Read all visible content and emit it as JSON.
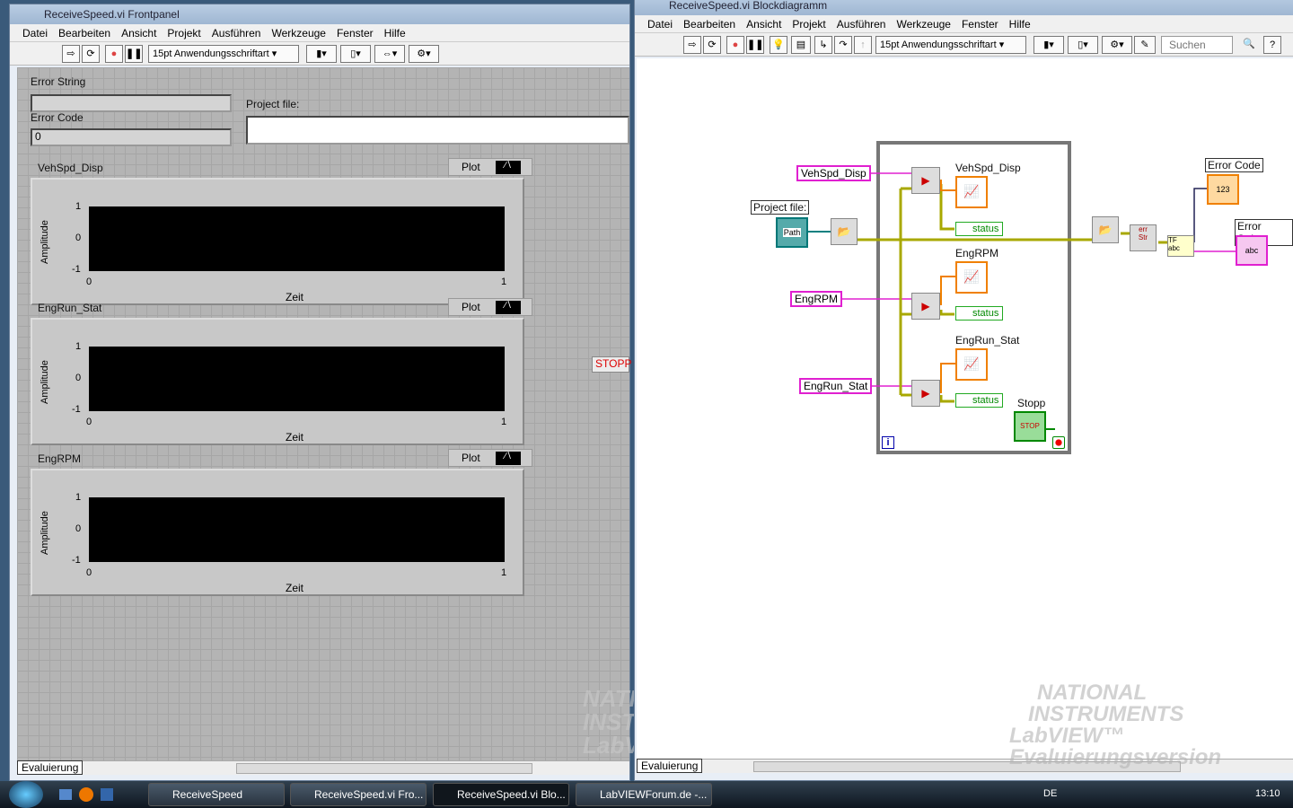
{
  "front_panel": {
    "title": "ReceiveSpeed.vi Frontpanel",
    "menu": [
      "Datei",
      "Bearbeiten",
      "Ansicht",
      "Projekt",
      "Ausführen",
      "Werkzeuge",
      "Fenster",
      "Hilfe"
    ],
    "font_select": "15pt Anwendungsschriftart",
    "error_string_label": "Error String",
    "error_string_value": "",
    "error_code_label": "Error Code",
    "error_code_value": "0",
    "project_file_label": "Project file:",
    "stop_button": "STOPP",
    "graphs": [
      {
        "title": "VehSpd_Disp",
        "legend": "Plot",
        "ylabel": "Amplitude",
        "xlabel": "Zeit",
        "yticks": [
          "1",
          "0",
          "-1"
        ],
        "xticks": [
          "0",
          "1"
        ]
      },
      {
        "title": "EngRun_Stat",
        "legend": "Plot",
        "ylabel": "Amplitude",
        "xlabel": "Zeit",
        "yticks": [
          "1",
          "0",
          "-1"
        ],
        "xticks": [
          "0",
          "1"
        ]
      },
      {
        "title": "EngRPM",
        "legend": "Plot",
        "ylabel": "Amplitude",
        "xlabel": "Zeit",
        "yticks": [
          "1",
          "0",
          "-1"
        ],
        "xticks": [
          "0",
          "1"
        ]
      }
    ],
    "status": "Evaluierung",
    "watermark": [
      "NATIONAL",
      "INSTRUMENTS",
      "LabVIEW"
    ]
  },
  "block_diagram": {
    "title": "ReceiveSpeed.vi Blockdiagramm",
    "menu": [
      "Datei",
      "Bearbeiten",
      "Ansicht",
      "Projekt",
      "Ausführen",
      "Werkzeuge",
      "Fenster",
      "Hilfe"
    ],
    "font_select": "15pt Anwendungsschriftart",
    "search_placeholder": "Suchen",
    "terminals": [
      "VehSpd_Disp",
      "EngRPM",
      "EngRun_Stat"
    ],
    "indicator_labels": [
      "VehSpd_Disp",
      "EngRPM",
      "EngRun_Stat"
    ],
    "status_labels": [
      "status",
      "status",
      "status"
    ],
    "project_file": "Project file:",
    "path_label": "Path",
    "error_code": "Error Code",
    "error_string": "Error String",
    "stop_label": "Stopp",
    "stop_text": "STOP",
    "loop_index": "i",
    "status": "Evaluierung",
    "watermark": [
      "NATIONAL",
      "INSTRUMENTS",
      "LabVIEW™ Evaluierungsversion"
    ]
  },
  "taskbar": {
    "items": [
      "ReceiveSpeed",
      "ReceiveSpeed.vi Fro...",
      "ReceiveSpeed.vi Blo...",
      "LabVIEWForum.de -..."
    ],
    "lang": "DE",
    "clock": "13:10"
  }
}
